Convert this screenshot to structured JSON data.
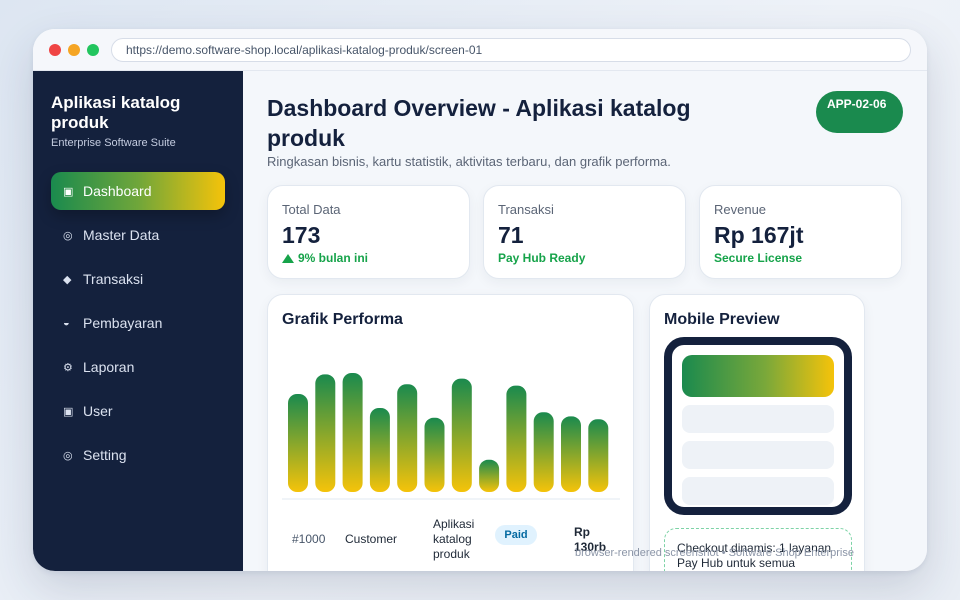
{
  "browser": {
    "url": "https://demo.software-shop.local/aplikasi-katalog-produk/screen-01"
  },
  "sidebar": {
    "brand_title": "Aplikasi katalog produk",
    "brand_subtitle": "Enterprise Software Suite",
    "items": [
      {
        "label": "Dashboard",
        "icon": "square-icon",
        "glyph": "▣",
        "active": true
      },
      {
        "label": "Master Data",
        "icon": "target-icon",
        "glyph": "◎",
        "active": false
      },
      {
        "label": "Transaksi",
        "icon": "diamond-icon",
        "glyph": "◆",
        "active": false
      },
      {
        "label": "Pembayaran",
        "icon": "half-circle-icon",
        "glyph": "◒",
        "active": false
      },
      {
        "label": "Laporan",
        "icon": "gear-icon",
        "glyph": "⚙",
        "active": false
      },
      {
        "label": "User",
        "icon": "square-icon",
        "glyph": "▣",
        "active": false
      },
      {
        "label": "Setting",
        "icon": "target-icon",
        "glyph": "◎",
        "active": false
      }
    ]
  },
  "header": {
    "title": "Dashboard Overview - Aplikasi katalog produk",
    "subtitle": "Ringkasan bisnis, kartu statistik, aktivitas terbaru, dan grafik performa.",
    "badge": "APP-02-06"
  },
  "stats": [
    {
      "label": "Total Data",
      "value": "173",
      "note": "9% bulan ini",
      "trend_icon": "up-triangle-icon"
    },
    {
      "label": "Transaksi",
      "value": "71",
      "note": "Pay Hub Ready"
    },
    {
      "label": "Revenue",
      "value": "Rp 167jt",
      "note": "Secure License"
    }
  ],
  "chart": {
    "title": "Grafik Performa"
  },
  "chart_data": {
    "type": "bar",
    "categories": [],
    "values": [
      70,
      84,
      85,
      60,
      77,
      53,
      81,
      23,
      76,
      57,
      54,
      52
    ],
    "ylim": [
      0,
      100
    ],
    "grid": false,
    "colors": {
      "top": "#1a8a4e",
      "bottom": "#f5c30a"
    }
  },
  "table": {
    "rows": [
      {
        "id": "#1000",
        "customer": "Customer",
        "product": "Aplikasi katalog produk",
        "status": "Paid",
        "amount": "Rp 130rb"
      }
    ]
  },
  "mobile": {
    "title": "Mobile Preview",
    "checkout_text": "Checkout dinamis: 1 layanan Pay Hub untuk semua"
  },
  "footer": {
    "text": "browser-rendered screenshot • Software Shop Enterprise"
  },
  "colors": {
    "sidebar_bg": "#14213d",
    "accent_green": "#1a8a4e",
    "accent_yellow": "#f5c30a",
    "positive": "#16a34a"
  }
}
